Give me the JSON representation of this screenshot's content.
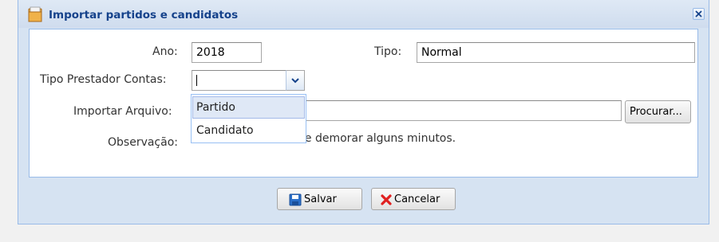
{
  "window": {
    "title": "Importar partidos e candidatos",
    "close_icon": "close-icon"
  },
  "form": {
    "ano_label": "Ano:",
    "ano_value": "2018",
    "tipo_label": "Tipo:",
    "tipo_value": "Normal",
    "tipo_prestador_label": "Tipo Prestador Contas:",
    "tipo_prestador_value": "",
    "importar_label": "Importar Arquivo:",
    "importar_value": "",
    "procurar_label": "Procurar...",
    "observacao_label": "Observação:",
    "observacao_text": "de demorar alguns minutos."
  },
  "dropdown": {
    "options": [
      "Partido",
      "Candidato"
    ],
    "highlighted_index": 0
  },
  "footer": {
    "save_label": "Salvar",
    "cancel_label": "Cancelar"
  },
  "colors": {
    "title": "#15428b",
    "window_bg": "#d6e3f2",
    "border": "#99bbe8",
    "cancel_icon": "#e02020",
    "save_icon": "#2a6fc9"
  }
}
